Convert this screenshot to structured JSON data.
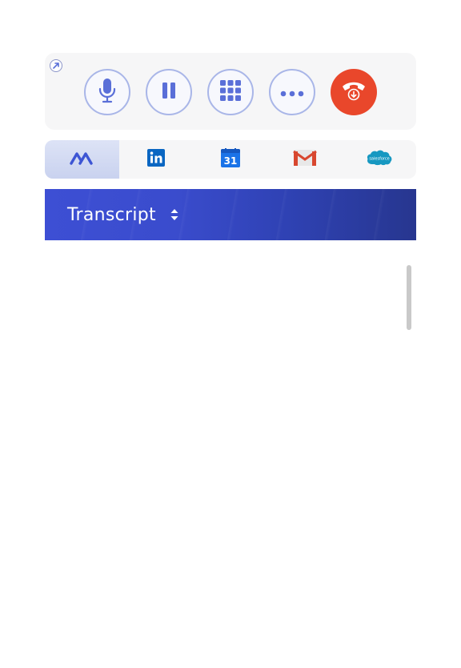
{
  "call_controls": {
    "popout_icon": "popout-icon",
    "buttons": [
      {
        "name": "mute",
        "icon": "microphone-icon"
      },
      {
        "name": "hold",
        "icon": "pause-icon"
      },
      {
        "name": "keypad",
        "icon": "keypad-icon"
      },
      {
        "name": "more",
        "icon": "more-icon"
      },
      {
        "name": "hang-up",
        "icon": "hang-up-icon"
      }
    ],
    "colors": {
      "accent": "#5a6fd8",
      "button_border": "#a9b6e8",
      "hang_up": "#e9472b"
    }
  },
  "integrations": {
    "tabs": [
      {
        "name": "app",
        "icon": "app-logo-icon",
        "active": true
      },
      {
        "name": "linkedin",
        "icon": "linkedin-icon",
        "active": false
      },
      {
        "name": "calendar",
        "icon": "calendar-icon",
        "text": "31",
        "active": false
      },
      {
        "name": "gmail",
        "icon": "gmail-icon",
        "active": false
      },
      {
        "name": "salesforce",
        "icon": "salesforce-icon",
        "text": "salesforce",
        "active": false
      }
    ]
  },
  "transcript": {
    "label": "Transcript",
    "sort_icon": "sort-icon",
    "colors": {
      "header_start": "#3d4fd4",
      "header_end": "#27368f"
    }
  }
}
